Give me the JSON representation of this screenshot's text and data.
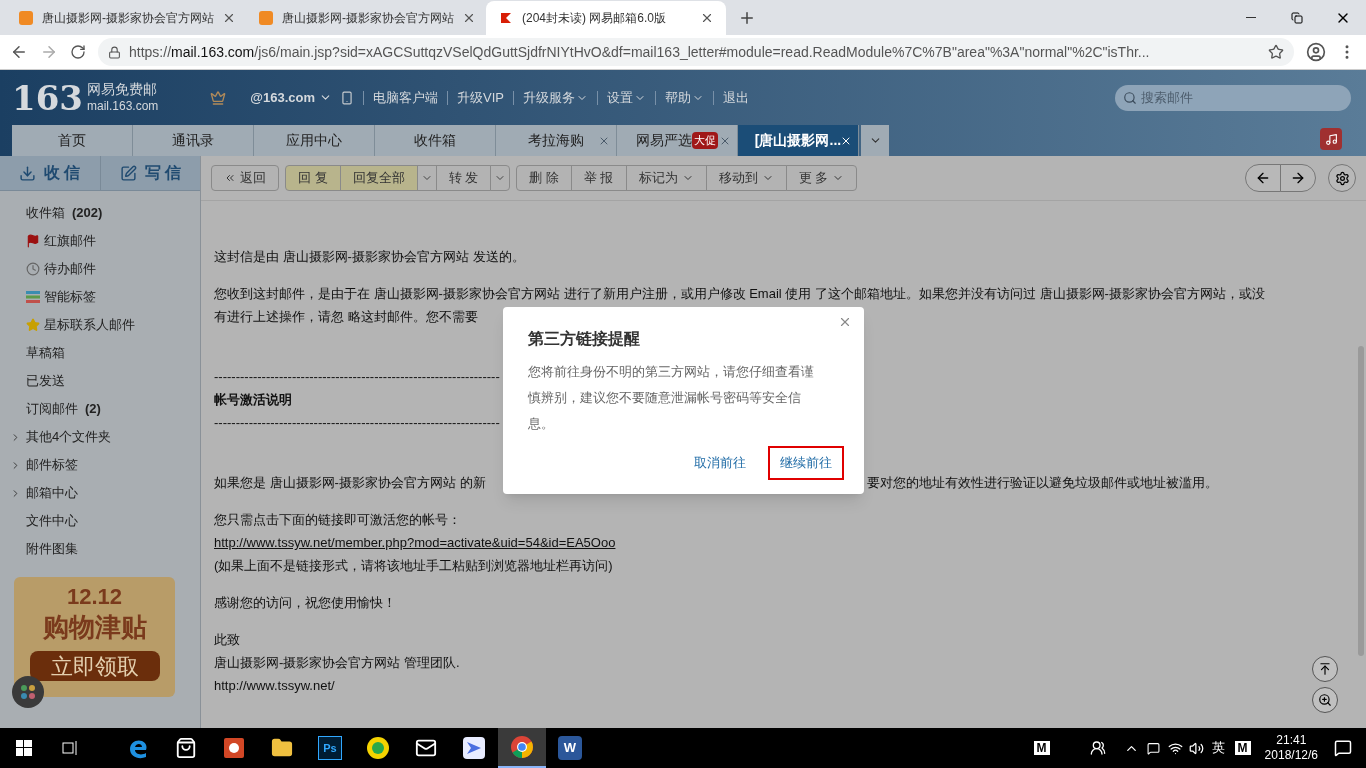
{
  "browser": {
    "tabs": [
      {
        "title": "唐山摄影网-摄影家协会官方网站",
        "kind": "site",
        "selected": false
      },
      {
        "title": "唐山摄影网-摄影家协会官方网站",
        "kind": "site",
        "selected": false
      },
      {
        "title": "(204封未读) 网易邮箱6.0版",
        "kind": "mail",
        "selected": true
      }
    ],
    "url_scheme": "https://",
    "url_host": "mail.163.com",
    "url_rest": "/js6/main.jsp?sid=xAGCSuttqzVSelQdGuttSjdfrNIYtHvO&df=mail163_letter#module=read.ReadModule%7C%7B\"area\"%3A\"normal\"%2C\"isThr..."
  },
  "header": {
    "logo": "163",
    "brand": "网易免费邮",
    "domain": "mail.163.com",
    "account": "@163.com",
    "links": [
      {
        "label": "电脑客户端",
        "dropdown": false
      },
      {
        "label": "升级VIP",
        "dropdown": false
      },
      {
        "label": "升级服务",
        "dropdown": true
      },
      {
        "label": "设置",
        "dropdown": true
      },
      {
        "label": "帮助",
        "dropdown": true
      },
      {
        "label": "退出",
        "dropdown": false
      }
    ],
    "search_placeholder": "搜索邮件"
  },
  "nav_tabs": [
    {
      "label": "首页",
      "closable": false,
      "selected": false
    },
    {
      "label": "通讯录",
      "closable": false,
      "selected": false
    },
    {
      "label": "应用中心",
      "closable": false,
      "selected": false
    },
    {
      "label": "收件箱",
      "closable": false,
      "selected": false
    },
    {
      "label": "考拉海购",
      "closable": true,
      "selected": false
    },
    {
      "label": "网易严选",
      "badge": "大促",
      "closable": true,
      "selected": false
    },
    {
      "label": "[唐山摄影网...",
      "closable": true,
      "selected": true
    }
  ],
  "sidebar": {
    "receive": "收 信",
    "compose": "写 信",
    "folders": [
      {
        "label": "收件箱",
        "count": "(202)",
        "kind": "plain",
        "expandable": false
      },
      {
        "label": "红旗邮件",
        "kind": "flag",
        "expandable": false
      },
      {
        "label": "待办邮件",
        "kind": "clock",
        "expandable": false
      },
      {
        "label": "智能标签",
        "kind": "tags",
        "expandable": false
      },
      {
        "label": "星标联系人邮件",
        "kind": "star",
        "expandable": false
      },
      {
        "label": "草稿箱",
        "kind": "plain",
        "expandable": false
      },
      {
        "label": "已发送",
        "kind": "plain",
        "expandable": false
      },
      {
        "label": "订阅邮件",
        "count": "(2)",
        "kind": "plain",
        "expandable": false
      },
      {
        "label": "其他4个文件夹",
        "kind": "plain",
        "expandable": true
      },
      {
        "label": "邮件标签",
        "kind": "plain",
        "expandable": true
      },
      {
        "label": "邮箱中心",
        "kind": "plain",
        "expandable": true
      },
      {
        "label": "文件中心",
        "kind": "plain",
        "expandable": false
      },
      {
        "label": "附件图集",
        "kind": "plain",
        "expandable": false
      }
    ],
    "ad": {
      "line1": "12.12",
      "line2": "购物津贴",
      "button": "立即领取"
    }
  },
  "toolbar": {
    "groups": [
      [
        {
          "label": "返回",
          "kind": "back",
          "highlighted": false
        }
      ],
      [
        {
          "label": "回 复",
          "kind": "plain",
          "highlighted": true
        },
        {
          "label": "回复全部",
          "kind": "plain",
          "highlighted": true
        },
        {
          "kind": "caret",
          "highlighted": false
        },
        {
          "label": "转 发",
          "kind": "plain",
          "highlighted": false
        },
        {
          "kind": "caret",
          "highlighted": false
        }
      ],
      [
        {
          "label": "删 除",
          "kind": "plain",
          "highlighted": false
        },
        {
          "label": "举 报",
          "kind": "plain",
          "highlighted": false
        },
        {
          "label": "标记为",
          "kind": "menu",
          "highlighted": false
        },
        {
          "label": "移动到",
          "kind": "menu",
          "highlighted": false
        },
        {
          "label": "更 多",
          "kind": "menu",
          "highlighted": false
        }
      ]
    ]
  },
  "email": {
    "body": [
      {
        "kind": "para",
        "text": "这封信是由 唐山摄影网-摄影家协会官方网站 发送的。"
      },
      {
        "kind": "para",
        "text": "您收到这封邮件，是由于在 唐山摄影网-摄影家协会官方网站 进行了新用户注册，或用户修改 Email 使用 了这个邮箱地址。如果您并没有访问过 唐山摄影网-摄影家协会官方网站，或没"
      },
      {
        "kind": "cont",
        "text": "有进行上述操作，请忽 略这封邮件。您不需要"
      },
      {
        "kind": "rule_top",
        "text": "------------------------------------------------------------------"
      },
      {
        "kind": "heading",
        "text": "帐号激活说明"
      },
      {
        "kind": "rule",
        "text": "------------------------------------------------------------------"
      },
      {
        "kind": "split",
        "text": "如果您是 唐山摄影网-摄影家协会官方网站 的新",
        "right": "要对您的地址有效性进行验证以避免垃圾邮件或地址被滥用。"
      },
      {
        "kind": "para",
        "text": "您只需点击下面的链接即可激活您的帐号："
      },
      {
        "kind": "link",
        "text": "http://www.tssyw.net/member.php?mod=activate&uid=54&id=EA5Ooo"
      },
      {
        "kind": "cont",
        "text": "(如果上面不是链接形式，请将该地址手工粘贴到浏览器地址栏再访问)"
      },
      {
        "kind": "para",
        "text": "感谢您的访问，祝您使用愉快！"
      },
      {
        "kind": "para",
        "text": "此致"
      },
      {
        "kind": "cont",
        "text": "唐山摄影网-摄影家协会官方网站 管理团队."
      },
      {
        "kind": "cont",
        "text": "http://www.tssyw.net/"
      }
    ]
  },
  "dialog": {
    "title": "第三方链接提醒",
    "message": "您将前往身份不明的第三方网站，请您仔细查看谨慎辨别，建议您不要随意泄漏帐号密码等安全信息。",
    "buttons": [
      {
        "label": "取消前往",
        "selected": false
      },
      {
        "label": "继续前往",
        "selected": true
      }
    ]
  },
  "taskbar": {
    "apps": [
      {
        "kind": "edge",
        "active": false
      },
      {
        "kind": "store",
        "active": false
      },
      {
        "kind": "ppt",
        "active": false
      },
      {
        "kind": "folder",
        "active": false
      },
      {
        "kind": "ps",
        "glyph": "Ps",
        "active": false
      },
      {
        "kind": "music",
        "active": false
      },
      {
        "kind": "mail",
        "active": false
      },
      {
        "kind": "bird",
        "active": false
      },
      {
        "kind": "chrome",
        "active": true
      },
      {
        "kind": "word",
        "glyph": "W",
        "active": false
      }
    ],
    "tray_badge": "M",
    "ime": "英",
    "ime_badge": "M",
    "time": "21:41",
    "date": "2018/12/6"
  }
}
